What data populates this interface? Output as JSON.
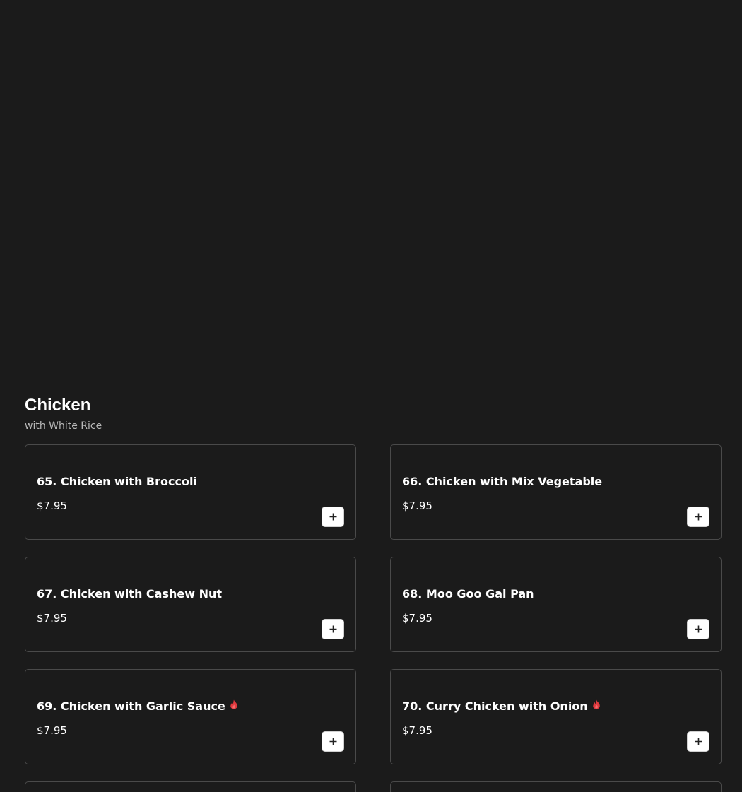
{
  "section": {
    "title": "Chicken",
    "subtitle": "with White Rice"
  },
  "colors": {
    "background": "#1b1b1b",
    "card_border": "#4a4a4a",
    "spicy": "#e0393e",
    "add_button_bg": "#ffffff"
  },
  "items": [
    {
      "name": "65. Chicken with Broccoli",
      "price": "$7.95",
      "spicy": false
    },
    {
      "name": "66. Chicken with Mix Vegetable",
      "price": "$7.95",
      "spicy": false
    },
    {
      "name": "67. Chicken with Cashew Nut",
      "price": "$7.95",
      "spicy": false
    },
    {
      "name": "68. Moo Goo Gai Pan",
      "price": "$7.95",
      "spicy": false
    },
    {
      "name": "69. Chicken with Garlic Sauce",
      "price": "$7.95",
      "spicy": true
    },
    {
      "name": "70. Curry Chicken with Onion",
      "price": "$7.95",
      "spicy": true
    }
  ],
  "icons": {
    "add": "plus-icon",
    "spicy": "flame-icon"
  }
}
